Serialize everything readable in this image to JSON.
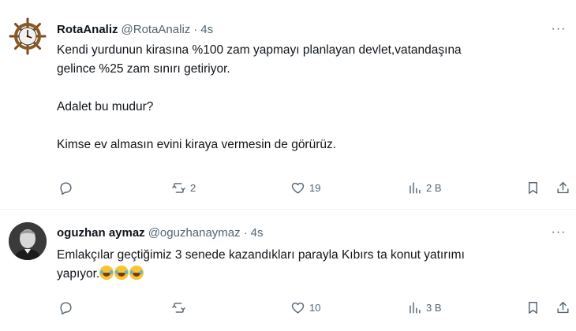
{
  "tweets": [
    {
      "name": "RotaAnaliz",
      "handle": "@RotaAnaliz",
      "separator": "·",
      "time": "4s",
      "more": "···",
      "lines": [
        "Kendi yurdunun kirasına %100 zam yapmayı planlayan devlet,vatandaşına",
        "gelince %25 zam sınırı getiriyor.",
        "",
        "Adalet bu mudur?",
        "",
        "Kimse ev almasın evini kiraya vermesin de görürüz."
      ],
      "actions": {
        "replies": "",
        "retweets": "2",
        "likes": "19",
        "views": "2 B"
      },
      "avatar_icon": "ship-wheel-clock-icon"
    },
    {
      "name": "oguzhan aymaz",
      "handle": "@oguzhanaymaz",
      "separator": "·",
      "time": "4s",
      "more": "···",
      "lines": [
        "Emlakçılar geçtiğimiz 3 senede kazandıkları parayla Kıbırs ta konut yatırımı",
        "yapıyor."
      ],
      "emoji_count": 3,
      "emoji_name": "rolling-on-floor-laughing",
      "actions": {
        "replies": "",
        "retweets": "",
        "likes": "10",
        "views": "3 B"
      },
      "avatar_icon": "portrait-photo"
    }
  ],
  "colors": {
    "text": "#0f1419",
    "secondary": "#536471",
    "divider": "#eff3f4",
    "background": "#ffffff"
  }
}
